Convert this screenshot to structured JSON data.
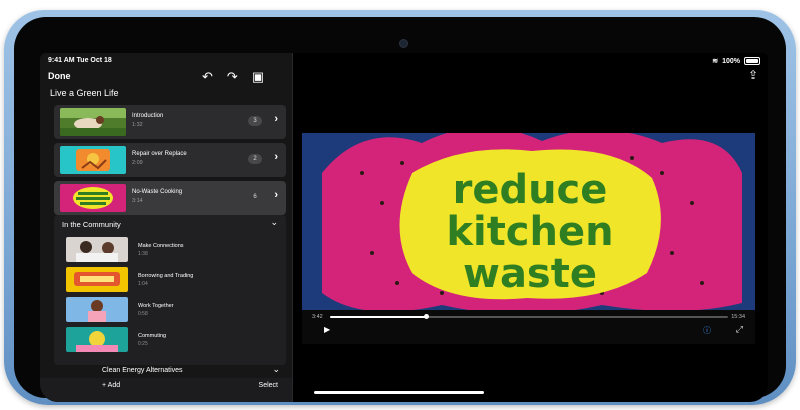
{
  "status": {
    "time": "9:41 AM",
    "date": "Tue Oct 18",
    "battery": "100%"
  },
  "toolbar": {
    "done_label": "Done",
    "icons": [
      "undo-icon",
      "redo-icon",
      "add-media-icon",
      "share-icon"
    ]
  },
  "project": {
    "title": "Live a Green Life",
    "clips": [
      {
        "title": "Introduction",
        "duration": "1:32",
        "count": "3"
      },
      {
        "title": "Repair over Replace",
        "duration": "2:09",
        "count": "2"
      },
      {
        "title": "No-Waste Cooking",
        "duration": "3:14",
        "count": "6"
      }
    ]
  },
  "community": {
    "title": "In the Community",
    "items": [
      {
        "title": "Make Connections",
        "duration": "1:38"
      },
      {
        "title": "Borrowing and Trading",
        "duration": "1:04"
      },
      {
        "title": "Work Together",
        "duration": "0:58"
      },
      {
        "title": "Commuting",
        "duration": "0:25"
      }
    ]
  },
  "clean_energy": {
    "title": "Clean Energy Alternatives"
  },
  "footer": {
    "add_label": "Add",
    "select_label": "Select"
  },
  "viewer": {
    "headline_lines": [
      "reduce",
      "kitchen",
      "waste"
    ],
    "time_current": "3:42",
    "time_total": "15:34",
    "progress": 0.24
  },
  "colors": {
    "accent": "#4a9bff",
    "device": "#8fb6df",
    "headline_text": "#2f7f22",
    "headline_fill": "#f1e52a",
    "background_pink": "#d4247a"
  }
}
